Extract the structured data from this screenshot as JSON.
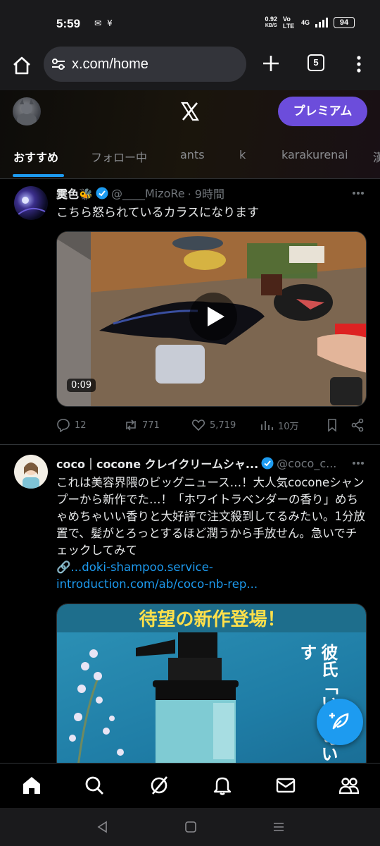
{
  "status_bar": {
    "time": "5:59",
    "net_speed_value": "0.92",
    "net_speed_unit": "KB/S",
    "volte": "Vo LTE",
    "signal": "4G",
    "battery": "94"
  },
  "browser": {
    "url": "x.com/home",
    "tab_count": "5"
  },
  "x_header": {
    "premium_label": "プレミアム",
    "tabs": [
      "おすすめ",
      "フォロー中",
      "ants",
      "k",
      "karakurenai",
      "漢"
    ]
  },
  "posts": [
    {
      "name": "霙色🐝",
      "handle": "@____MizoRe",
      "time": "· 9時間",
      "text": "こちら怒られているカラスになります",
      "video_duration": "0:09",
      "replies": "12",
      "reposts": "771",
      "likes": "5,719",
      "views": "10万"
    },
    {
      "name": "coco｜cocone クレイクリームシャ...",
      "handle": "@coco_c...",
      "text": "これは美容界隈のビッグニュース…！大人気coconeシャンプーから新作でた…！「ホワイトラベンダーの香り」めちゃめちゃいい香りと大好評で注文殺到してるみたい。1分放置で、髪がとろっとするほど潤うから手放せん。急いでチェックしてみて",
      "link_line1": "🔗...doki-shampoo.service-",
      "link_line2": "introduction.com/ab/coco-nb-rep...",
      "ad_banner": "待望の新作登場！",
      "ad_side_text": "彼氏「いい匂いす"
    }
  ],
  "colors": {
    "accent": "#1d9bf0",
    "premium": "#6c4ddb",
    "background": "#000000",
    "muted": "#71767b"
  },
  "bottom_nav": [
    "home-icon",
    "search-icon",
    "grok-icon",
    "notifications-icon",
    "messages-icon",
    "communities-icon"
  ],
  "system_nav": [
    "back-icon",
    "home-circle-icon",
    "recents-icon"
  ]
}
